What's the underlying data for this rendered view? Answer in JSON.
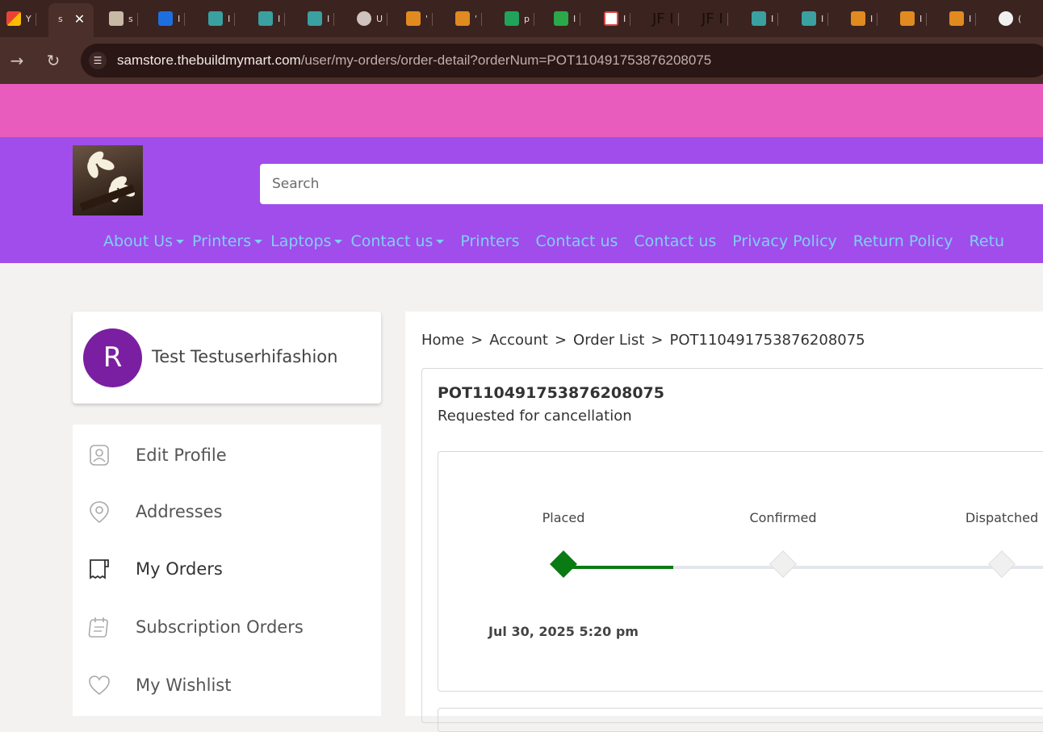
{
  "browser": {
    "url_host": "samstore.thebuildmymart.com",
    "url_path": "/user/my-orders/order-detail?orderNum=POT110491753876208075",
    "active_tab_letter": "s",
    "tab_letters": [
      "Y",
      "s",
      "s",
      "I",
      "I",
      "I",
      "I",
      "U",
      "'",
      "'",
      "p",
      "I",
      "I",
      "JF I",
      "JF I",
      "I",
      "I",
      "I",
      "I",
      "I",
      "("
    ]
  },
  "search": {
    "placeholder": "Search"
  },
  "nav": {
    "items": [
      {
        "label": "About Us",
        "dropdown": true
      },
      {
        "label": "Printers",
        "dropdown": true
      },
      {
        "label": "Laptops",
        "dropdown": true
      },
      {
        "label": "Contact us",
        "dropdown": true
      },
      {
        "label": "Printers",
        "dropdown": false
      },
      {
        "label": "Contact us",
        "dropdown": false
      },
      {
        "label": "Contact us",
        "dropdown": false
      },
      {
        "label": "Privacy Policy",
        "dropdown": false
      },
      {
        "label": "Return Policy",
        "dropdown": false
      },
      {
        "label": "Retu",
        "dropdown": false
      }
    ]
  },
  "profile": {
    "initial": "R",
    "name": "Test Testuserhifashion"
  },
  "menu": {
    "items": [
      {
        "label": "Edit Profile",
        "icon": "user-profile-icon"
      },
      {
        "label": "Addresses",
        "icon": "map-pin-icon"
      },
      {
        "label": "My Orders",
        "icon": "receipt-icon"
      },
      {
        "label": "Subscription Orders",
        "icon": "calendar-icon"
      },
      {
        "label": "My Wishlist",
        "icon": "heart-icon"
      }
    ],
    "active": "My Orders"
  },
  "breadcrumb": {
    "home": "Home",
    "account": "Account",
    "order_list": "Order List",
    "current": "POT110491753876208075",
    "separator": ">"
  },
  "order": {
    "number": "POT110491753876208075",
    "status": "Requested for cancellation",
    "steps": [
      {
        "label": "Placed",
        "done": true,
        "date": "Jul 30, 2025 5:20 pm"
      },
      {
        "label": "Confirmed",
        "done": false,
        "date": ""
      },
      {
        "label": "Dispatched",
        "done": false,
        "date": ""
      }
    ]
  },
  "colors": {
    "promo_bar": "#e85cbd",
    "header": "#a04deb",
    "nav_link": "#7fd0f5",
    "avatar": "#7b1fa2",
    "progress_done": "#0a7a12",
    "progress_pending": "#e3e6ec"
  }
}
